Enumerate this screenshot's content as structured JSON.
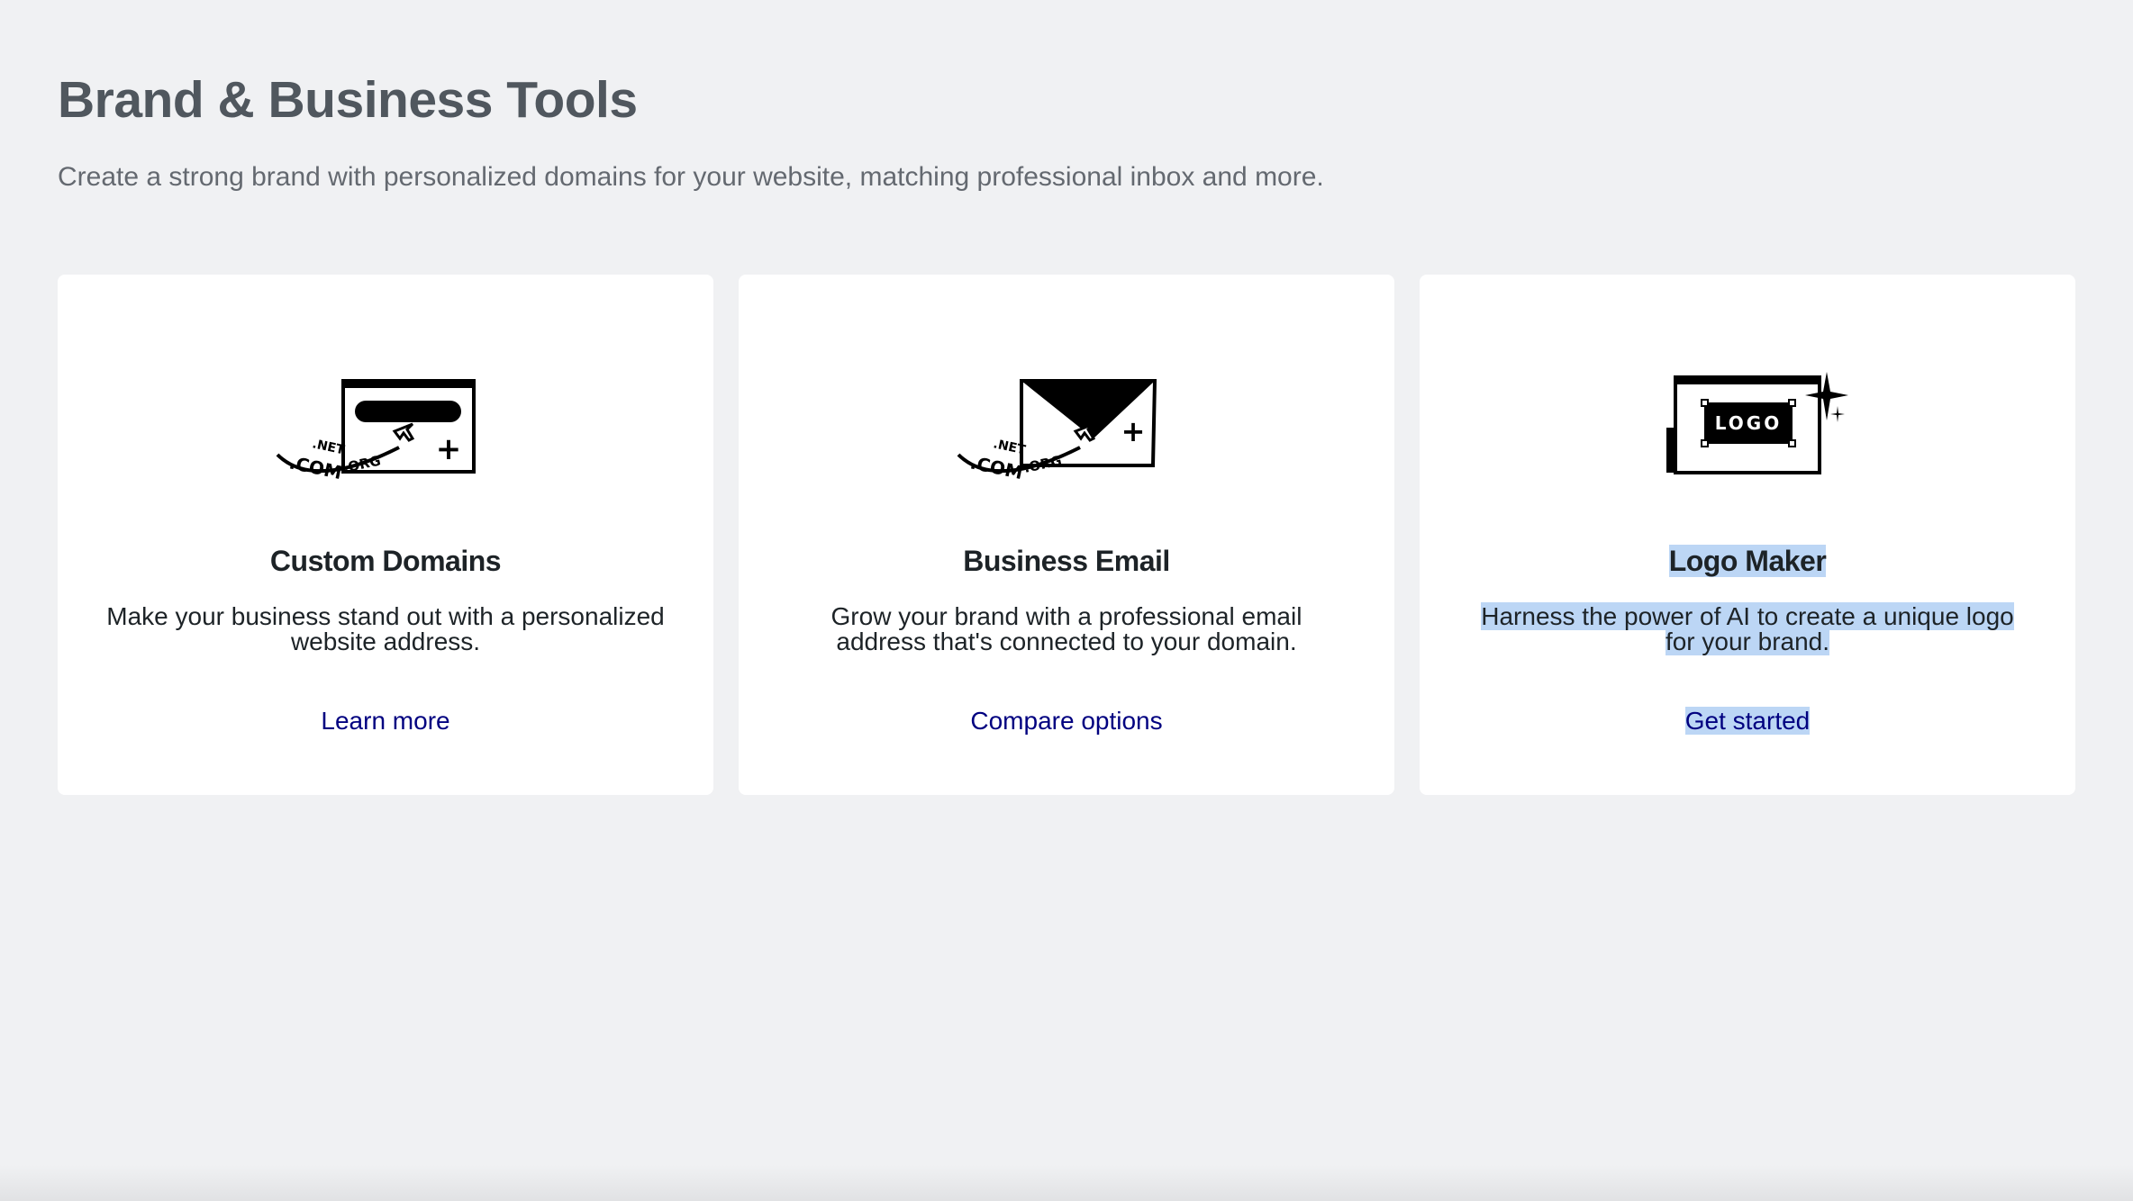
{
  "header": {
    "title": "Brand & Business Tools",
    "subtitle": "Create a strong brand with personalized domains for your website, matching professional inbox and more."
  },
  "cards": [
    {
      "icon": "domain-browser-icon",
      "title": "Custom Domains",
      "description": "Make your business stand out with a personalized website address.",
      "link": "Learn more",
      "illustration_text": [
        ".COM",
        ".NET",
        ".ORG"
      ]
    },
    {
      "icon": "email-envelope-icon",
      "title": "Business Email",
      "description": "Grow your brand with a professional email address that's connected to your domain.",
      "link": "Compare options",
      "illustration_text": [
        ".COM",
        ".NET",
        ".ORG"
      ]
    },
    {
      "icon": "logo-maker-icon",
      "title": "Logo Maker",
      "description": "Harness the power of AI to create a unique logo for your brand.",
      "link": "Get started",
      "illustration_text": [
        "LOGO"
      ]
    }
  ],
  "colors": {
    "background": "#f0f1f3",
    "card": "#ffffff",
    "link": "#000080",
    "selection": "#bcd6f5"
  }
}
